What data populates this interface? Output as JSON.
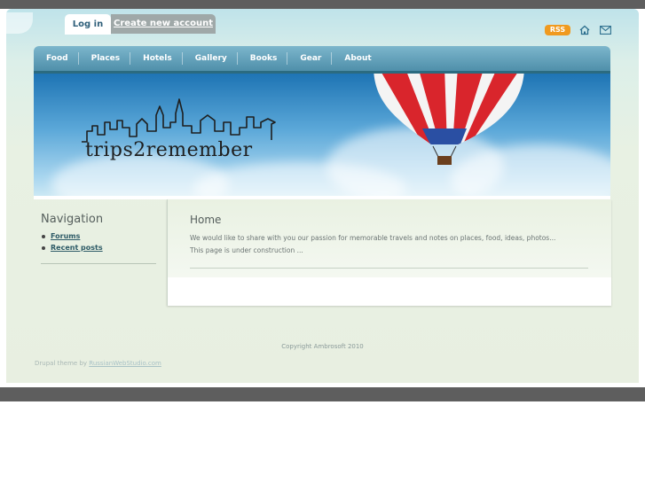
{
  "account_tabs": {
    "login": "Log in",
    "create": "Create new account"
  },
  "header_links": {
    "rss": "RSS",
    "home_icon": "home-icon",
    "mail_icon": "mail-icon"
  },
  "nav": {
    "items": [
      {
        "label": "Food"
      },
      {
        "label": "Places"
      },
      {
        "label": "Hotels"
      },
      {
        "label": "Gallery"
      },
      {
        "label": "Books"
      },
      {
        "label": "Gear"
      },
      {
        "label": "About"
      }
    ]
  },
  "banner": {
    "logo_text": "trips2remember"
  },
  "sidebar": {
    "title": "Navigation",
    "links": [
      {
        "label": "Forums"
      },
      {
        "label": "Recent posts"
      }
    ]
  },
  "content": {
    "title": "Home",
    "lines": [
      "We would like to share with you our passion for memorable travels and notes on places, food, ideas, photos...",
      "This page is under construction ..."
    ]
  },
  "footer": {
    "copyright": "Copyright Ambrosoft 2010",
    "credit_prefix": "Drupal theme by",
    "credit_link": "RussianWebStudio.com"
  },
  "colors": {
    "accent": "#4f8faa",
    "rss": "#f09a1f",
    "frame": "#5e5e5e"
  }
}
